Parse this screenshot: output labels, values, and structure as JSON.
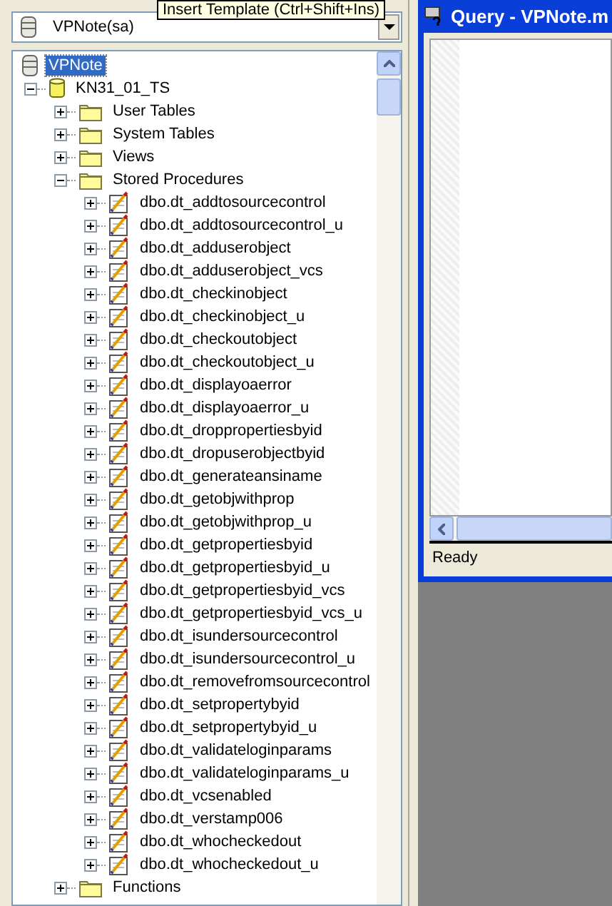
{
  "tooltip": "Insert Template (Ctrl+Shift+Ins)",
  "server_select": {
    "value": "VPNote(sa)"
  },
  "tree": [
    {
      "label": "VPNote",
      "kind": "server",
      "selected": true,
      "children": [
        {
          "label": "KN31_01_TS",
          "kind": "database",
          "selected": false,
          "expanded": true,
          "children": [
            {
              "label": "User Tables",
              "kind": "folder",
              "selected": false,
              "expanded": false
            },
            {
              "label": "System Tables",
              "kind": "folder",
              "selected": false,
              "expanded": false
            },
            {
              "label": "Views",
              "kind": "folder",
              "selected": false,
              "expanded": false
            },
            {
              "label": "Stored Procedures",
              "kind": "folder",
              "selected": false,
              "expanded": true,
              "children": [
                {
                  "label": "dbo.dt_addtosourcecontrol",
                  "kind": "procedure",
                  "selected": false,
                  "expanded": false
                },
                {
                  "label": "dbo.dt_addtosourcecontrol_u",
                  "kind": "procedure",
                  "selected": false,
                  "expanded": false
                },
                {
                  "label": "dbo.dt_adduserobject",
                  "kind": "procedure",
                  "selected": false,
                  "expanded": false
                },
                {
                  "label": "dbo.dt_adduserobject_vcs",
                  "kind": "procedure",
                  "selected": false,
                  "expanded": false
                },
                {
                  "label": "dbo.dt_checkinobject",
                  "kind": "procedure",
                  "selected": false,
                  "expanded": false
                },
                {
                  "label": "dbo.dt_checkinobject_u",
                  "kind": "procedure",
                  "selected": false,
                  "expanded": false
                },
                {
                  "label": "dbo.dt_checkoutobject",
                  "kind": "procedure",
                  "selected": false,
                  "expanded": false
                },
                {
                  "label": "dbo.dt_checkoutobject_u",
                  "kind": "procedure",
                  "selected": false,
                  "expanded": false
                },
                {
                  "label": "dbo.dt_displayoaerror",
                  "kind": "procedure",
                  "selected": false,
                  "expanded": false
                },
                {
                  "label": "dbo.dt_displayoaerror_u",
                  "kind": "procedure",
                  "selected": false,
                  "expanded": false
                },
                {
                  "label": "dbo.dt_droppropertiesbyid",
                  "kind": "procedure",
                  "selected": false,
                  "expanded": false
                },
                {
                  "label": "dbo.dt_dropuserobjectbyid",
                  "kind": "procedure",
                  "selected": false,
                  "expanded": false
                },
                {
                  "label": "dbo.dt_generateansiname",
                  "kind": "procedure",
                  "selected": false,
                  "expanded": false
                },
                {
                  "label": "dbo.dt_getobjwithprop",
                  "kind": "procedure",
                  "selected": false,
                  "expanded": false
                },
                {
                  "label": "dbo.dt_getobjwithprop_u",
                  "kind": "procedure",
                  "selected": false,
                  "expanded": false
                },
                {
                  "label": "dbo.dt_getpropertiesbyid",
                  "kind": "procedure",
                  "selected": false,
                  "expanded": false
                },
                {
                  "label": "dbo.dt_getpropertiesbyid_u",
                  "kind": "procedure",
                  "selected": false,
                  "expanded": false
                },
                {
                  "label": "dbo.dt_getpropertiesbyid_vcs",
                  "kind": "procedure",
                  "selected": false,
                  "expanded": false
                },
                {
                  "label": "dbo.dt_getpropertiesbyid_vcs_u",
                  "kind": "procedure",
                  "selected": false,
                  "expanded": false
                },
                {
                  "label": "dbo.dt_isundersourcecontrol",
                  "kind": "procedure",
                  "selected": false,
                  "expanded": false
                },
                {
                  "label": "dbo.dt_isundersourcecontrol_u",
                  "kind": "procedure",
                  "selected": false,
                  "expanded": false
                },
                {
                  "label": "dbo.dt_removefromsourcecontrol",
                  "kind": "procedure",
                  "selected": false,
                  "expanded": false
                },
                {
                  "label": "dbo.dt_setpropertybyid",
                  "kind": "procedure",
                  "selected": false,
                  "expanded": false
                },
                {
                  "label": "dbo.dt_setpropertybyid_u",
                  "kind": "procedure",
                  "selected": false,
                  "expanded": false
                },
                {
                  "label": "dbo.dt_validateloginparams",
                  "kind": "procedure",
                  "selected": false,
                  "expanded": false
                },
                {
                  "label": "dbo.dt_validateloginparams_u",
                  "kind": "procedure",
                  "selected": false,
                  "expanded": false
                },
                {
                  "label": "dbo.dt_vcsenabled",
                  "kind": "procedure",
                  "selected": false,
                  "expanded": false
                },
                {
                  "label": "dbo.dt_verstamp006",
                  "kind": "procedure",
                  "selected": false,
                  "expanded": false
                },
                {
                  "label": "dbo.dt_whocheckedout",
                  "kind": "procedure",
                  "selected": false,
                  "expanded": false
                },
                {
                  "label": "dbo.dt_whocheckedout_u",
                  "kind": "procedure",
                  "selected": false,
                  "expanded": false
                }
              ]
            },
            {
              "label": "Functions",
              "kind": "folder",
              "selected": false,
              "expanded": false
            }
          ]
        }
      ]
    }
  ],
  "query_window": {
    "title": "Query - VPNote.m",
    "status": "Ready"
  }
}
